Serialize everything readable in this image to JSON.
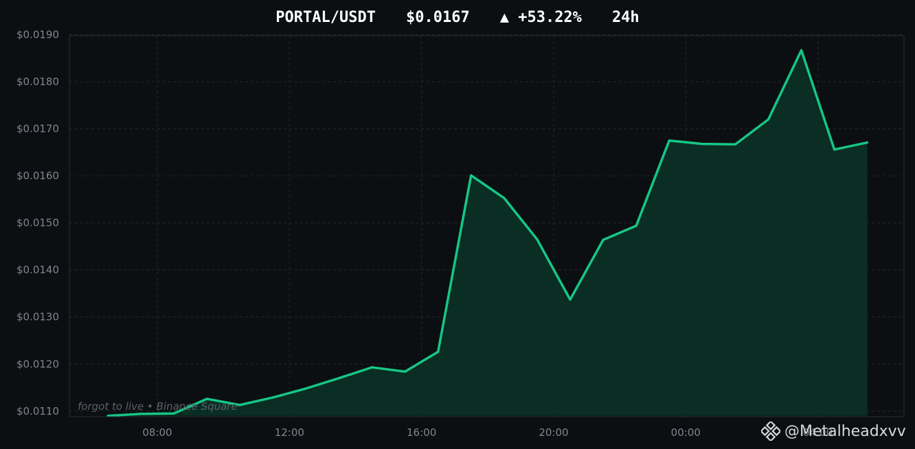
{
  "header": {
    "pair": "PORTAL/USDT",
    "price": "$0.0167",
    "change": "▲ +53.22%",
    "period": "24h"
  },
  "watermark": {
    "source": "forgot to live  •  Binance Square",
    "handle": "@Metalheadxvv",
    "logo_icon": "binance-logo"
  },
  "colors": {
    "background": "#0c0f12",
    "line": "#16c784",
    "fill": "#0b2f26",
    "grid": "#23282d"
  },
  "chart_data": {
    "type": "area",
    "x": [
      "06:30",
      "07:30",
      "08:30",
      "09:30",
      "10:30",
      "11:30",
      "12:30",
      "13:30",
      "14:30",
      "15:30",
      "16:30",
      "17:30",
      "18:30",
      "19:30",
      "20:30",
      "21:30",
      "22:30",
      "23:30",
      "00:30",
      "01:30",
      "02:30",
      "03:30",
      "04:30",
      "05:30"
    ],
    "series": [
      {
        "values": [
          0.0109,
          0.01094,
          0.01095,
          0.01126,
          0.01113,
          0.01129,
          0.01148,
          0.0117,
          0.01193,
          0.01184,
          0.01226,
          0.01601,
          0.01553,
          0.01465,
          0.01337,
          0.01464,
          0.01494,
          0.01675,
          0.01668,
          0.01667,
          0.0172,
          0.01867,
          0.01656,
          0.01671
        ]
      }
    ],
    "x_ticks": [
      "08:00",
      "12:00",
      "16:00",
      "20:00",
      "00:00",
      "04:00"
    ],
    "y_ticks": [
      "$0.0110",
      "$0.0120",
      "$0.0130",
      "$0.0140",
      "$0.0150",
      "$0.0160",
      "$0.0170",
      "$0.0180",
      "$0.0190"
    ],
    "ylim": [
      0.01088,
      0.01898
    ],
    "grid": true,
    "legend": "none"
  }
}
